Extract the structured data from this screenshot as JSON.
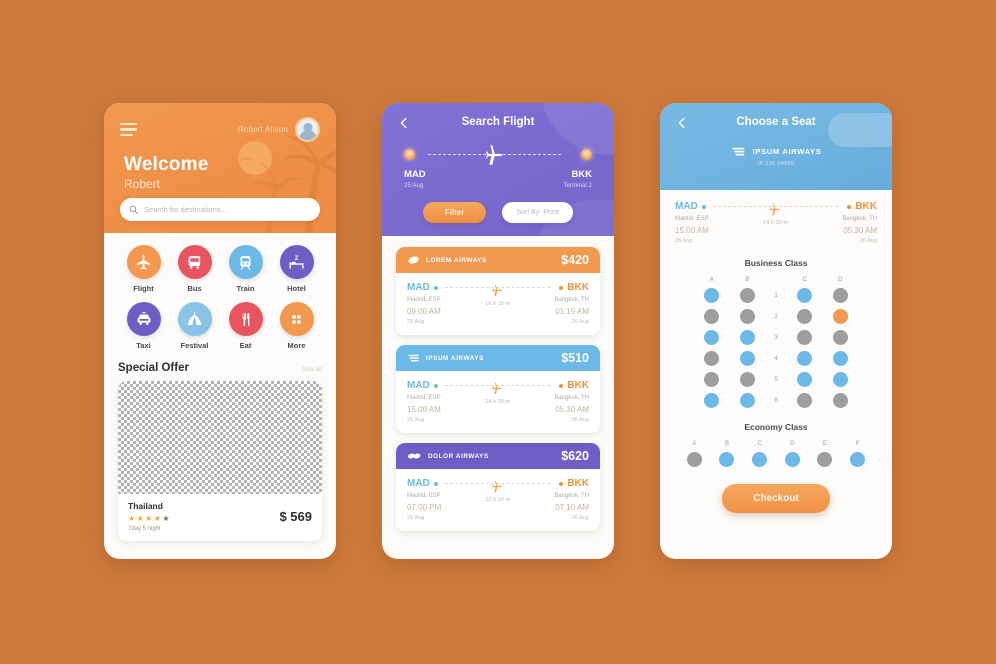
{
  "theme": {
    "page_background": "#ce7a3c",
    "orange": "#f2994f",
    "purple": "#7b6ad0",
    "blue": "#6eb3e0",
    "seat_available": "#6cb8e6",
    "seat_taken": "#9e9e9e",
    "seat_selected": "#f2994f"
  },
  "home": {
    "menu_icon": "hamburger-icon",
    "user_name": "Robert Alison",
    "avatar_icon": "avatar-icon",
    "notification_icon": "notification-dot-icon",
    "welcome_title": "Welcome",
    "welcome_sub": "Robert",
    "search": {
      "icon": "search-icon",
      "placeholder": "Search for destinations..."
    },
    "categories": [
      {
        "label": "Flight",
        "icon": "airplane-icon",
        "color": "#f2994f"
      },
      {
        "label": "Bus",
        "icon": "bus-icon",
        "color": "#e8545f"
      },
      {
        "label": "Train",
        "icon": "train-icon",
        "color": "#6cb8e6"
      },
      {
        "label": "Hotel",
        "icon": "bed-icon",
        "color": "#6d5ec6"
      },
      {
        "label": "Taxi",
        "icon": "taxi-icon",
        "color": "#6d5ec6"
      },
      {
        "label": "Festival",
        "icon": "tent-icon",
        "color": "#89c4e8"
      },
      {
        "label": "Eat",
        "icon": "cutlery-icon",
        "color": "#e8545f"
      },
      {
        "label": "More",
        "icon": "more-dots-icon",
        "color": "#f2994f"
      }
    ],
    "section": {
      "title": "Special Offer",
      "see_all": "See all"
    },
    "offer": {
      "name": "Thailand",
      "stars_filled": 4,
      "stars_total": 5,
      "duration": "7day 5 night",
      "price": "$ 569"
    }
  },
  "search_flight": {
    "back_icon": "back-arrow-icon",
    "title": "Search Flight",
    "route": {
      "origin_code": "MAD",
      "origin_sub": "25 Aug",
      "dest_code": "BKK",
      "dest_sub": "Terminal 2",
      "plane_icon": "airplane-icon"
    },
    "filter_button": "Filter",
    "sort_button": "Sort By: Price",
    "flights": [
      {
        "airline": "LOREM AIRWAYS",
        "airline_icon": "oval-logo-icon",
        "price": "$420",
        "header_color": "#f2994f",
        "origin_code": "MAD",
        "origin_city": "Madrid, ESP",
        "origin_time": "09.00 AM",
        "origin_date": "25 Aug",
        "duration": "16 h 15 m",
        "dest_code": "BKK",
        "dest_city": "Bangkok, TH",
        "dest_time": "01.15 AM",
        "dest_date": "26 Aug"
      },
      {
        "airline": "IPSUM AIRWAYS",
        "airline_icon": "stripes-logo-icon",
        "price": "$510",
        "header_color": "#6cb8e6",
        "origin_code": "MAD",
        "origin_city": "Madrid, ESP",
        "origin_time": "15.00 AM",
        "origin_date": "25 Aug",
        "duration": "14 h 30 m",
        "dest_code": "BKK",
        "dest_city": "Bangkok, TH",
        "dest_time": "05.30 AM",
        "dest_date": "26 Aug"
      },
      {
        "airline": "DOLOR AIRWAYS",
        "airline_icon": "double-oval-logo-icon",
        "price": "$620",
        "header_color": "#6d5ec6",
        "origin_code": "MAD",
        "origin_city": "Madrid, ESP",
        "origin_time": "07.00 PM",
        "origin_date": "25 Aug",
        "duration": "12 h 10 m",
        "dest_code": "BKK",
        "dest_city": "Bangkok, TH",
        "dest_time": "07.10 AM",
        "dest_date": "26 Aug"
      }
    ]
  },
  "choose_seat": {
    "back_icon": "back-arrow-icon",
    "title": "Choose a Seat",
    "airline": "IPSUM AIRWAYS",
    "airline_icon": "stripes-logo-icon",
    "flight_no": "IP 226 04695",
    "summary": {
      "origin_code": "MAD",
      "origin_city": "Madrid, ESP",
      "origin_time": "15.00 AM",
      "origin_date": "25 Aug",
      "duration": "14 h 30 m",
      "dest_code": "BKK",
      "dest_city": "Bangkok, TH",
      "dest_time": "05.30 AM",
      "dest_date": "26 Aug"
    },
    "business": {
      "title": "Business Class",
      "columns": [
        "A",
        "B",
        "C",
        "D"
      ],
      "rows": [
        {
          "number": "1",
          "seats": [
            "available",
            "taken",
            "available",
            "taken"
          ]
        },
        {
          "number": "2",
          "seats": [
            "taken",
            "taken",
            "taken",
            "selected"
          ]
        },
        {
          "number": "3",
          "seats": [
            "available",
            "available",
            "taken",
            "taken"
          ]
        },
        {
          "number": "4",
          "seats": [
            "taken",
            "available",
            "available",
            "available"
          ]
        },
        {
          "number": "5",
          "seats": [
            "taken",
            "taken",
            "available",
            "available"
          ]
        },
        {
          "number": "6",
          "seats": [
            "available",
            "available",
            "taken",
            "taken"
          ]
        }
      ]
    },
    "economy": {
      "title": "Economy Class",
      "columns": [
        "A",
        "B",
        "C",
        "D",
        "E",
        "F"
      ],
      "seats": [
        "taken",
        "available",
        "available",
        "available",
        "taken",
        "available"
      ]
    },
    "checkout_button": "Checkout"
  }
}
